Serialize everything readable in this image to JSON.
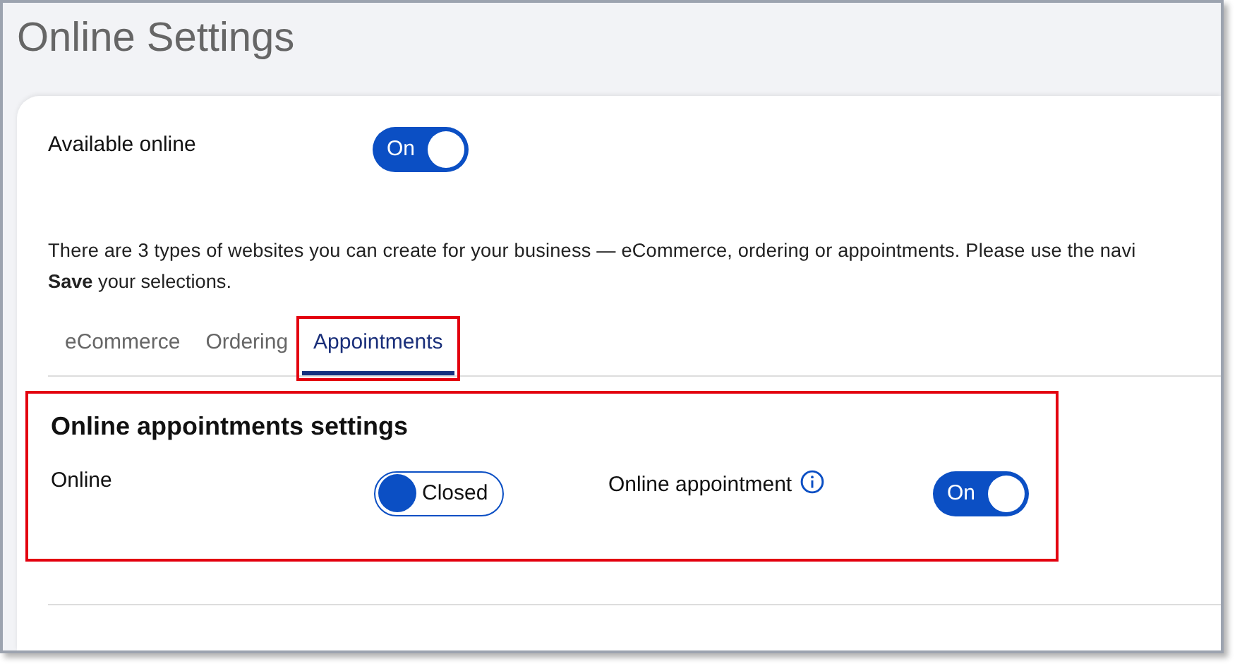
{
  "page_title": "Online Settings",
  "available_online": {
    "label": "Available online",
    "toggle": {
      "on": true,
      "text": "On"
    }
  },
  "intro": [
    "There are 3 types of websites you can create for your business — eCommerce, ordering or appointments. Please use the navi",
    "**Save** your selections."
  ],
  "tabs": [
    {
      "label": "eCommerce",
      "selected": false,
      "annotated": false
    },
    {
      "label": "Ordering",
      "selected": false,
      "annotated": false
    },
    {
      "label": "Appointments",
      "selected": true,
      "annotated": true
    }
  ],
  "section": {
    "title": "Online appointments settings",
    "annotated": true,
    "settings": [
      {
        "label": "Online",
        "info": false,
        "toggle": {
          "on": false,
          "text": "Closed"
        }
      },
      {
        "label": "Online appointment",
        "info": true,
        "toggle": {
          "on": true,
          "text": "On"
        }
      }
    ]
  }
}
